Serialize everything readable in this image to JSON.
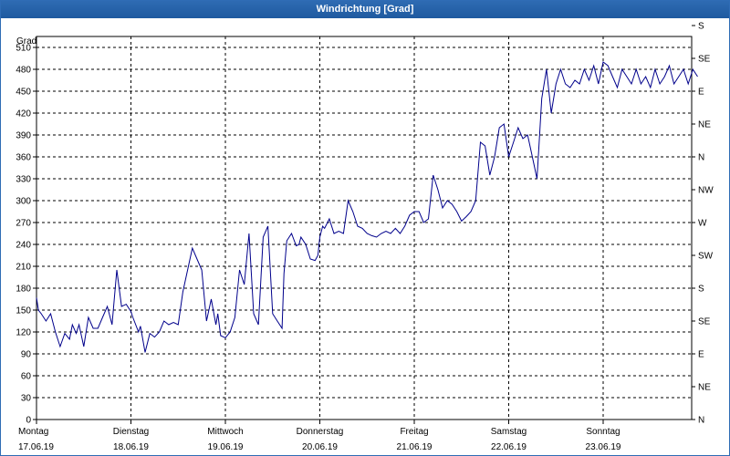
{
  "window": {
    "title": "Windrichtung [Grad]"
  },
  "chart_data": {
    "type": "line",
    "title": "Windrichtung [Grad]",
    "ylabel": "Grad",
    "ylim": [
      0,
      525
    ],
    "y_ticks": [
      0,
      30,
      60,
      90,
      120,
      150,
      180,
      210,
      240,
      270,
      300,
      330,
      360,
      390,
      420,
      450,
      480,
      510
    ],
    "right_axis_labels": [
      "N",
      "NE",
      "E",
      "SE",
      "S",
      "SW",
      "W",
      "NW",
      "N",
      "NE",
      "E",
      "SE",
      "S"
    ],
    "x_labels": [
      {
        "day": "Montag",
        "date": "17.06.19"
      },
      {
        "day": "Dienstag",
        "date": "18.06.19"
      },
      {
        "day": "Mittwoch",
        "date": "19.06.19"
      },
      {
        "day": "Donnerstag",
        "date": "20.06.19"
      },
      {
        "day": "Freitag",
        "date": "21.06.19"
      },
      {
        "day": "Samstag",
        "date": "22.06.19"
      },
      {
        "day": "Sonntag",
        "date": "23.06.19"
      }
    ],
    "xlim": [
      0,
      7
    ],
    "grid": true,
    "series": [
      {
        "color": "#00008b",
        "x": [
          0.0,
          0.02,
          0.05,
          0.1,
          0.15,
          0.2,
          0.25,
          0.3,
          0.35,
          0.38,
          0.42,
          0.45,
          0.5,
          0.55,
          0.6,
          0.65,
          0.7,
          0.75,
          0.8,
          0.85,
          0.9,
          0.95,
          1.0,
          1.02,
          1.05,
          1.08,
          1.1,
          1.15,
          1.2,
          1.25,
          1.3,
          1.35,
          1.4,
          1.45,
          1.5,
          1.55,
          1.6,
          1.65,
          1.7,
          1.75,
          1.8,
          1.85,
          1.9,
          1.92,
          1.95,
          2.0,
          2.05,
          2.1,
          2.15,
          2.2,
          2.25,
          2.3,
          2.35,
          2.4,
          2.45,
          2.5,
          2.55,
          2.6,
          2.62,
          2.65,
          2.7,
          2.75,
          2.78,
          2.8,
          2.85,
          2.9,
          2.95,
          2.98,
          3.0,
          3.03,
          3.05,
          3.1,
          3.15,
          3.2,
          3.25,
          3.3,
          3.35,
          3.4,
          3.45,
          3.5,
          3.55,
          3.6,
          3.65,
          3.7,
          3.75,
          3.8,
          3.85,
          3.9,
          3.95,
          4.0,
          4.05,
          4.1,
          4.15,
          4.2,
          4.25,
          4.3,
          4.35,
          4.4,
          4.45,
          4.5,
          4.55,
          4.6,
          4.65,
          4.7,
          4.75,
          4.8,
          4.85,
          4.9,
          4.95,
          5.0,
          5.05,
          5.1,
          5.15,
          5.2,
          5.25,
          5.3,
          5.35,
          5.4,
          5.45,
          5.5,
          5.55,
          5.6,
          5.65,
          5.7,
          5.75,
          5.8,
          5.85,
          5.9,
          5.95,
          6.0,
          6.05,
          6.1,
          6.15,
          6.2,
          6.25,
          6.3,
          6.35,
          6.4,
          6.45,
          6.5,
          6.55,
          6.6,
          6.65,
          6.7,
          6.75,
          6.8,
          6.85,
          6.9,
          6.95,
          7.0
        ],
        "y": [
          167,
          150,
          145,
          135,
          145,
          120,
          100,
          118,
          110,
          130,
          118,
          130,
          100,
          140,
          125,
          125,
          140,
          155,
          130,
          205,
          155,
          158,
          148,
          140,
          130,
          120,
          128,
          92,
          118,
          113,
          120,
          135,
          130,
          133,
          130,
          175,
          205,
          235,
          220,
          205,
          135,
          165,
          130,
          145,
          115,
          112,
          120,
          140,
          205,
          185,
          255,
          145,
          130,
          250,
          265,
          145,
          135,
          125,
          200,
          245,
          255,
          238,
          240,
          250,
          240,
          220,
          218,
          225,
          250,
          265,
          262,
          275,
          255,
          258,
          255,
          300,
          285,
          265,
          262,
          255,
          252,
          250,
          255,
          258,
          255,
          262,
          255,
          265,
          280,
          285,
          285,
          270,
          275,
          335,
          315,
          290,
          300,
          295,
          285,
          272,
          278,
          285,
          300,
          380,
          375,
          335,
          360,
          400,
          405,
          360,
          380,
          400,
          385,
          390,
          360,
          330,
          440,
          480,
          420,
          460,
          480,
          460,
          455,
          465,
          460,
          480,
          465,
          485,
          460,
          490,
          485,
          470,
          455,
          480,
          470,
          460,
          480,
          460,
          470,
          455,
          480,
          460,
          470,
          485,
          460,
          470,
          480,
          460,
          480,
          470
        ]
      }
    ]
  }
}
